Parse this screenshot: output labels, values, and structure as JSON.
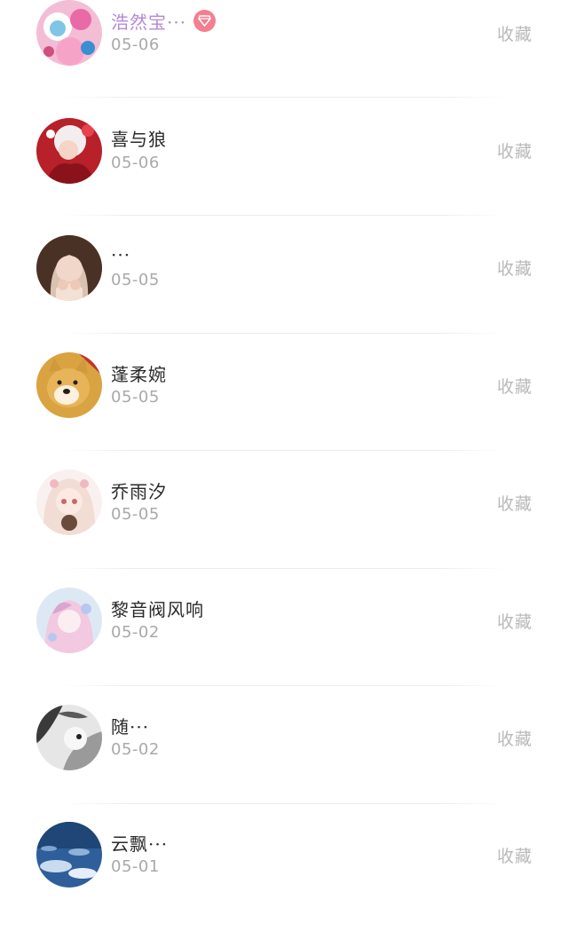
{
  "favorite_label": "收藏",
  "items": [
    {
      "name": "浩然宝···",
      "date": "05-06",
      "vip": true,
      "avatar_icon": "pink-cartoon-avatar-icon"
    },
    {
      "name": "喜与狼",
      "date": "05-06",
      "vip": false,
      "avatar_icon": "red-anime-girl-avatar-icon"
    },
    {
      "name": "···",
      "date": "05-05",
      "vip": false,
      "avatar_icon": "girl-photo-avatar-icon"
    },
    {
      "name": "蓬柔婉",
      "date": "05-05",
      "vip": false,
      "avatar_icon": "shiba-dog-avatar-icon"
    },
    {
      "name": "乔雨汐",
      "date": "05-05",
      "vip": false,
      "avatar_icon": "anime-girl-bear-avatar-icon"
    },
    {
      "name": "黎音阀风响",
      "date": "05-02",
      "vip": false,
      "avatar_icon": "pastel-anime-avatar-icon"
    },
    {
      "name": "随···",
      "date": "05-02",
      "vip": false,
      "avatar_icon": "monochrome-anime-avatar-icon"
    },
    {
      "name": "云飘···",
      "date": "05-01",
      "vip": false,
      "avatar_icon": "blue-sky-avatar-icon"
    }
  ],
  "colors": {
    "vip_name": "#b489d6",
    "vip_badge": "#f47f8f",
    "name": "#2a2a2a",
    "date": "#a9a9a9",
    "favorite": "#b9b9b9"
  }
}
